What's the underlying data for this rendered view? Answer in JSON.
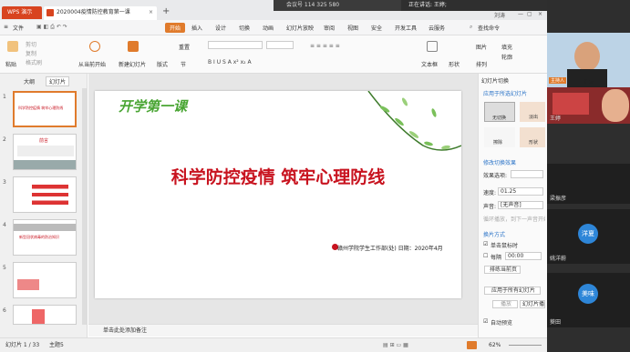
{
  "titlebar": {
    "wps_tab": "WPS 演示",
    "doc_tab": "2020004疫情防控教育第一课",
    "meeting_id": "会议号 114 325 580",
    "speaking": "正在讲话: 王婷;",
    "user": "刘涛"
  },
  "menu": {
    "file": "文件",
    "items": [
      "开始",
      "插入",
      "设计",
      "切换",
      "动画",
      "幻灯片放映",
      "审阅",
      "视图",
      "安全",
      "开发工具",
      "云服务"
    ],
    "search": "查找命令"
  },
  "ribbon": {
    "paste": "粘贴",
    "cut": "剪切",
    "copy": "复制",
    "format_painter": "格式刷",
    "from_current": "从当前开始",
    "new_slide": "新建幻灯片",
    "layout": "版式",
    "section": "节",
    "reset": "重置",
    "textbox": "文本框",
    "shape": "形状",
    "arrange": "排列",
    "picture": "图片",
    "fill": "填充",
    "outline": "轮廓"
  },
  "sidepane": {
    "tab_outline": "大纲",
    "tab_slides": "幻灯片",
    "slide_numbers": [
      "1",
      "2",
      "3",
      "4",
      "5",
      "6"
    ],
    "slide1_title": "科学防控疫情 筑牢心理防线",
    "slide2_title": "前言",
    "slide4_title": "新型冠状病毒的防治知识"
  },
  "slide": {
    "kicker": "开学第一课",
    "title": "科学防控疫情  筑牢心理防线",
    "footer": "赣州学院学生工作部(处)  日期：2020年4月"
  },
  "notes": "单击此处添加备注",
  "status": {
    "slide_count": "幻灯片 1 / 33",
    "theme": "主题5",
    "zoom": "62%"
  },
  "rightpane": {
    "header": "幻灯片切换",
    "apply_selected": "应用于所选幻灯片",
    "no_transition": "无切换",
    "fade": "淡出",
    "erase": "擦除",
    "shape": "形状",
    "modify": "修改切换效果",
    "effect_option": "效果选项:",
    "speed_label": "速度:",
    "speed_value": "01.25",
    "sound_label": "声音:",
    "sound_value": "[无声音]",
    "loop": "循环播放，到下一声音开始时",
    "advance": "换片方式",
    "on_click": "单击鼠标时",
    "every": "每隔",
    "every_value": "00:00",
    "sort": "排练当前页",
    "apply_all": "应用于所有幻灯片",
    "play": "播放",
    "show": "幻灯片播放",
    "auto_preview": "自动预览"
  },
  "video": {
    "tiles": [
      "主持人",
      "刘涛",
      "王婷",
      "梁振彦",
      "洋夏",
      "姚洋蔚",
      "美味",
      "葵田"
    ]
  }
}
